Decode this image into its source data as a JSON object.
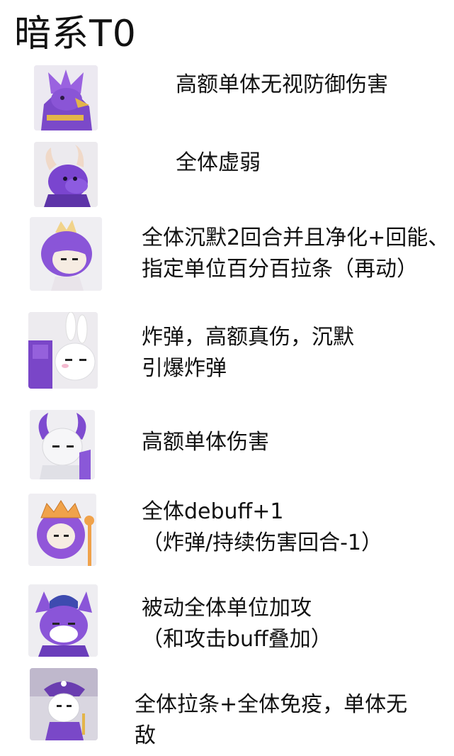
{
  "title": "暗系T0",
  "heroes": [
    {
      "avatar": "purple-dragon-knight-portrait",
      "lines": [
        "高额单体无视防御伤害"
      ]
    },
    {
      "avatar": "purple-horned-dragon-portrait",
      "lines": [
        "全体虚弱"
      ]
    },
    {
      "avatar": "purple-haired-crowned-prince-portrait",
      "lines": [
        "全体沉默2回合并且净化+回能、",
        "指定单位百分百拉条（再动）"
      ]
    },
    {
      "avatar": "white-bunny-eared-character-portrait",
      "lines": [
        "炸弹，高额真伤，沉默",
        "引爆炸弹"
      ]
    },
    {
      "avatar": "white-horned-knight-portrait",
      "lines": [
        "高额单体伤害"
      ]
    },
    {
      "avatar": "orange-crowned-purple-queen-portrait",
      "lines": [
        "全体debuff+1",
        "（炸弹/持续伤害回合-1）"
      ]
    },
    {
      "avatar": "purple-fox-soldier-portrait",
      "lines": [
        "被动全体单位加攻",
        "（和攻击buff叠加）"
      ]
    },
    {
      "avatar": "white-haired-pirate-captain-portrait",
      "lines": [
        "全体拉条+全体免疫，单体无",
        "敌"
      ]
    }
  ]
}
